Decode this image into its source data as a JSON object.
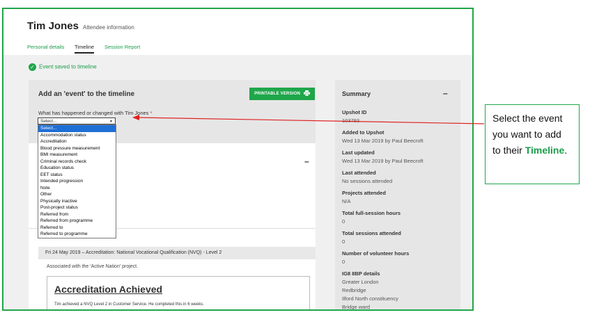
{
  "header": {
    "name": "Tim Jones",
    "subtitle": "Attendee information",
    "tabs": [
      {
        "label": "Personal details"
      },
      {
        "label": "Timeline"
      },
      {
        "label": "Session Report"
      }
    ]
  },
  "success_message": "Event saved to timeline",
  "add_event": {
    "title": "Add an 'event' to the timeline",
    "print_button": "PRINTABLE VERSION",
    "question": "What has happened or changed with Tim Jones",
    "required_mark": "*",
    "select_value": "Select...",
    "options": [
      "Select...",
      "Accommodation status",
      "Accreditation",
      "Blood pressure measurement",
      "BMI measurement",
      "Criminal records check",
      "Education status",
      "EET status",
      "Intended progression",
      "Note",
      "Other",
      "Physically inactive",
      "Post-project status",
      "Referred from",
      "Referred from programme",
      "Referred to",
      "Referred to programme"
    ]
  },
  "timeline_entry": {
    "bar_text": "Fri 24 May 2019 – Accreditation: National Vocational Qualification (NVQ) - Level 2",
    "associated": "Associated with the 'Active Nation' project.",
    "card_title": "Accreditation Achieved",
    "card_text": "Tim achieved a NVQ Level 2 in Customer Service. He completed this in 6 weeks."
  },
  "summary": {
    "title": "Summary",
    "collapse": "–",
    "items": [
      {
        "label": "Upshot ID",
        "value": "103793"
      },
      {
        "label": "Added to Upshot",
        "value": "Wed 13 Mar 2019 by Paul Beecroft"
      },
      {
        "label": "Last updated",
        "value": "Wed 13 Mar 2019 by Paul Beecroft"
      },
      {
        "label": "Last attended",
        "value": "No sessions attended"
      },
      {
        "label": "Projects attended",
        "value": "N/A"
      },
      {
        "label": "Total full-session hours",
        "value": "0"
      },
      {
        "label": "Total sessions attended",
        "value": "0"
      },
      {
        "label": "Number of volunteer hours",
        "value": "0"
      }
    ],
    "ig8": {
      "label": "IG8 8BP details",
      "lines": [
        "Greater London",
        "Redbridge",
        "Ilford North constituency",
        "Bridge ward"
      ]
    }
  },
  "callout": {
    "text": "Select the event you want to add to their",
    "highlight": "Timeline",
    "end": "."
  },
  "colors": {
    "accent": "#1fa64a",
    "arrow": "#e02020",
    "selection": "#1e6fd6"
  }
}
